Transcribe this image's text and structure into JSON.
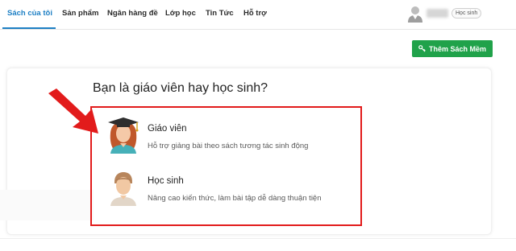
{
  "nav": {
    "items": [
      {
        "label": "Sách của tôi",
        "active": true
      },
      {
        "label": "Sản phẩm",
        "active": false
      },
      {
        "label": "Ngân hàng đề",
        "active": false
      },
      {
        "label": "Lớp học",
        "active": false
      },
      {
        "label": "Tin Tức",
        "active": false
      },
      {
        "label": "Hỗ trợ",
        "active": false
      }
    ],
    "user_role_badge": "Học sinh",
    "accent_color": "#1d7fc4"
  },
  "toolbar": {
    "add_book_label": "Thêm Sách Mềm",
    "add_book_icon": "key-icon",
    "button_color": "#20a24a"
  },
  "main": {
    "question": "Bạn là giáo viên hay học sinh?",
    "options": [
      {
        "title": "Giáo viên",
        "description": "Hỗ trợ giảng bài theo sách tương tác sinh động",
        "icon": "teacher-graduate-avatar-icon"
      },
      {
        "title": "Học sinh",
        "description": "Nâng cao kiến thức, làm bài tập dễ dàng thuận tiện",
        "icon": "student-avatar-icon"
      }
    ],
    "highlight_color": "#e21b1b"
  }
}
